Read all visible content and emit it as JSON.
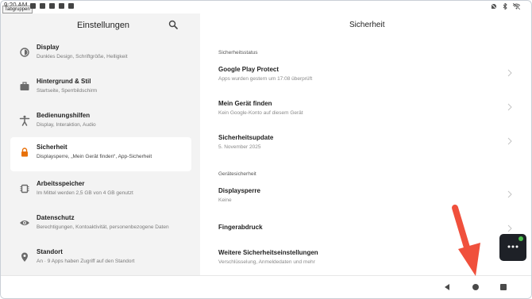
{
  "status_bar": {
    "time": "9:20 AM",
    "tooltip": "Tabgruppen",
    "left_icons": [
      "notification-icon",
      "message-icon",
      "screen-icon",
      "volume-icon",
      "app-icon"
    ],
    "right_icons": [
      "no-sim-icon",
      "bluetooth-icon",
      "wifi-icon"
    ]
  },
  "settings": {
    "title": "Einstellungen",
    "items": [
      {
        "title": "Display",
        "subtitle": "Dunkles Design, Schriftgröße, Helligkeit",
        "icon": "display-icon",
        "active": false
      },
      {
        "title": "Hintergrund & Stil",
        "subtitle": "Startseite, Sperrbildschirm",
        "icon": "wallpaper-icon",
        "active": false
      },
      {
        "title": "Bedienungshilfen",
        "subtitle": "Display, Interaktion, Audio",
        "icon": "accessibility-icon",
        "active": false
      },
      {
        "title": "Sicherheit",
        "subtitle": "Displaysperre, „Mein Gerät finden“, App-Sicherheit",
        "icon": "lock-icon",
        "active": true
      },
      {
        "title": "Arbeitsspeicher",
        "subtitle": "Im Mittel werden 2,5 GB von 4 GB genutzt",
        "icon": "memory-icon",
        "active": false
      },
      {
        "title": "Datenschutz",
        "subtitle": "Berechtigungen, Kontoaktivität, personenbezogene Daten",
        "icon": "privacy-eye-icon",
        "active": false
      },
      {
        "title": "Standort",
        "subtitle": "An · 9 Apps haben Zugriff auf den Standort",
        "icon": "location-icon",
        "active": false
      }
    ]
  },
  "security": {
    "title": "Sicherheit",
    "status_header": "Sicherheitsstatus",
    "status_rows": [
      {
        "title": "Google Play Protect",
        "subtitle": "Apps wurden gestern um 17:08 überprüft"
      },
      {
        "title": "Mein Gerät finden",
        "subtitle": "Kein Google-Konto auf diesem Gerät"
      },
      {
        "title": "Sicherheitsupdate",
        "subtitle": "5. November 2025"
      }
    ],
    "device_header": "Gerätesicherheit",
    "device_rows": [
      {
        "title": "Displaysperre",
        "subtitle": "Keine"
      },
      {
        "title": "Fingerabdruck",
        "subtitle": ""
      },
      {
        "title": "Weitere Sicherheitseinstellungen",
        "subtitle": "Verschlüsselung, Anmeldedaten und mehr"
      }
    ]
  },
  "colors": {
    "accent": "#e8710a",
    "left_pane_bg": "#f3f3f3",
    "annotation_arrow": "#f0503c"
  }
}
